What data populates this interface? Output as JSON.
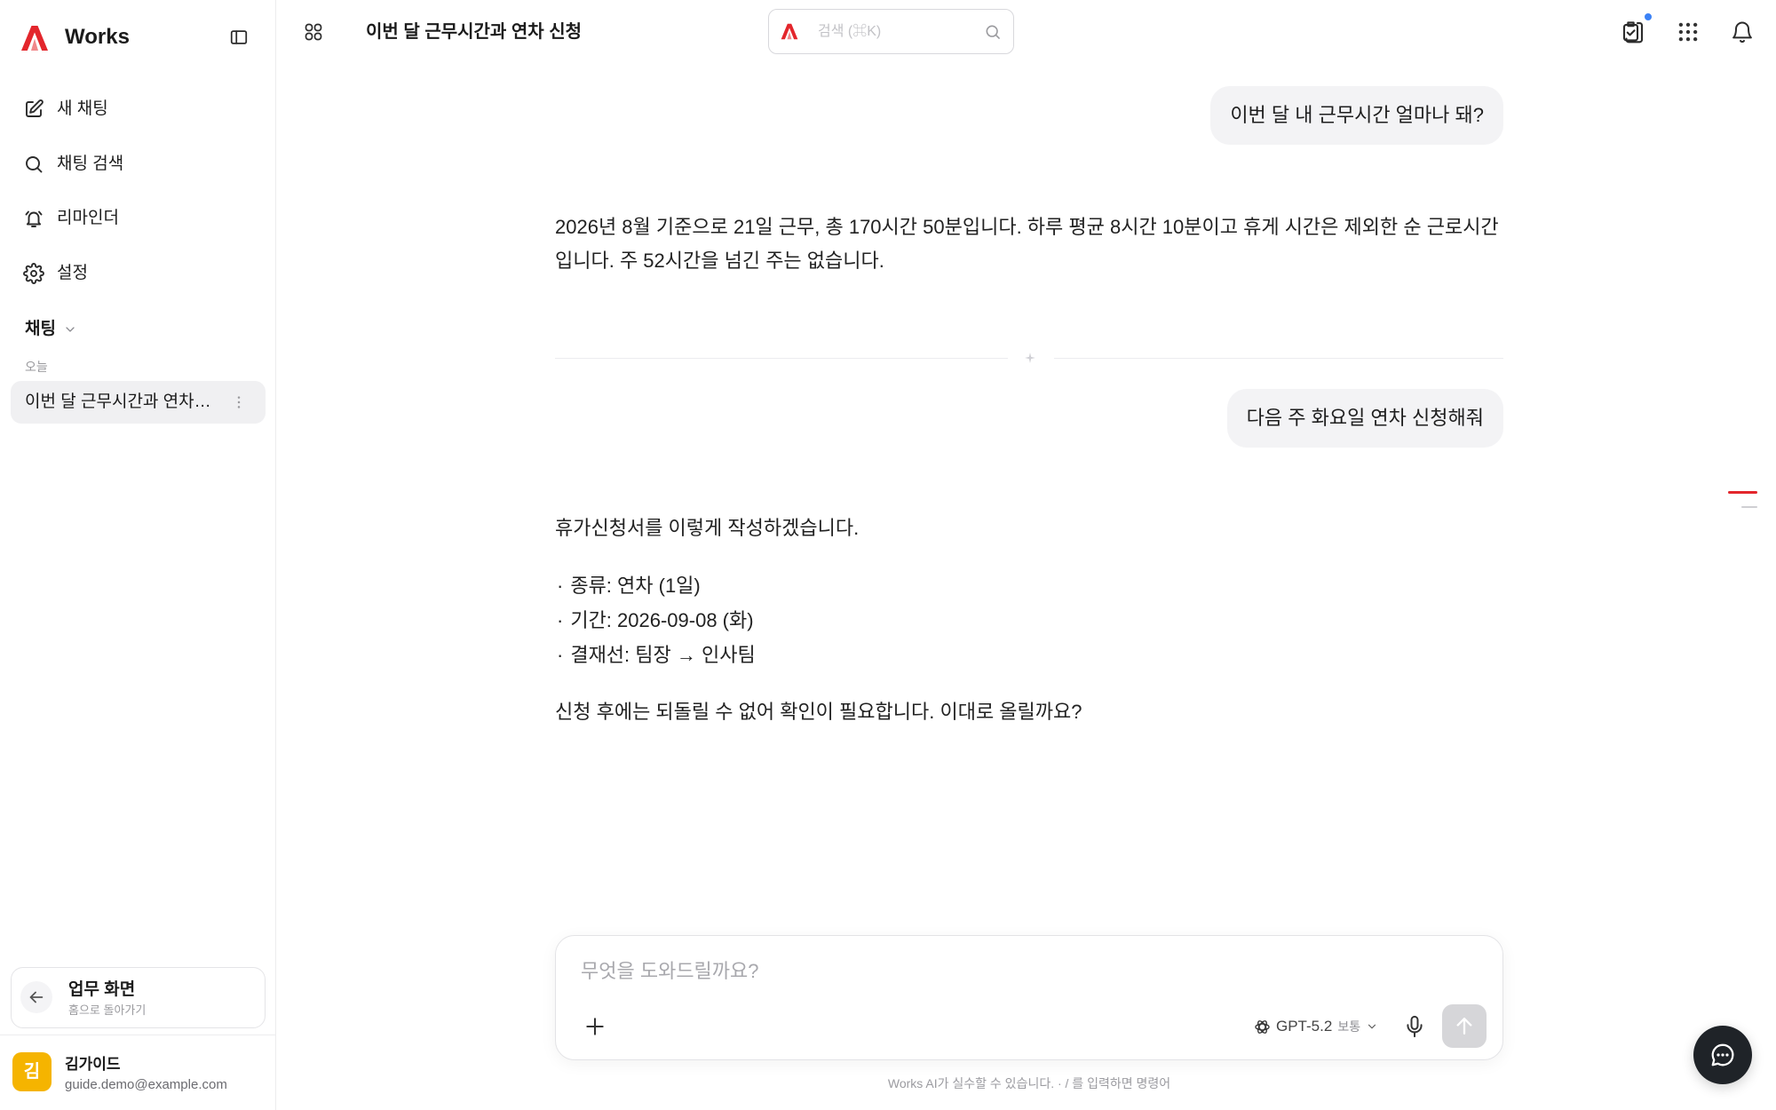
{
  "theme": {
    "accent": "#e3262c",
    "badge": "#3b82f6",
    "avatar": "#f5b400",
    "fab": "#1f2328"
  },
  "app": {
    "logo_text": "Works"
  },
  "sidebar": {
    "nav": [
      {
        "label": "새 채팅",
        "icon": "edit-icon"
      },
      {
        "label": "채팅 검색",
        "icon": "search-icon"
      },
      {
        "label": "리마인더",
        "icon": "alarm-icon"
      },
      {
        "label": "설정",
        "icon": "gear-icon"
      }
    ],
    "section_title": "채팅",
    "group_label": "오늘",
    "chats": [
      {
        "title": "이번 달 근무시간과 연차…",
        "selected": true
      }
    ],
    "workspace": {
      "title": "업무 화면",
      "subtitle": "홈으로 돌아가기"
    },
    "user": {
      "initial": "김",
      "name": "김가이드",
      "email": "guide.demo@example.com"
    }
  },
  "header": {
    "title": "이번 달 근무시간과 연차 신청",
    "search_placeholder": "검색 (⌘K)"
  },
  "conversation": [
    {
      "question": "이번 달 내 근무시간 얼마나 돼?",
      "answer": {
        "paragraphs": [
          "2026년 8월 기준으로 21일 근무, 총 170시간 50분입니다. 하루 평균 8시간 10분이고 휴게 시간은 제외한 순 근로시간입니다. 주 52시간을 넘긴 주는 없습니다."
        ]
      }
    },
    {
      "question": "다음 주 화요일 연차 신청해줘",
      "answer": {
        "intro": "휴가신청서를 이렇게 작성하겠습니다.",
        "items": [
          {
            "marker": "·",
            "text": "종류: 연차 (1일)"
          },
          {
            "marker": "·",
            "text": "기간: 2026-09-08 (화)"
          },
          {
            "marker": "·",
            "text": "결재선: 팀장 → 인사팀"
          }
        ],
        "closing": "신청 후에는 되돌릴 수 없어 확인이 필요합니다. 이대로 올릴까요?"
      }
    }
  ],
  "composer": {
    "placeholder": "무엇을 도와드릴까요?",
    "model_name": "GPT-5.2",
    "model_effort": "보통"
  },
  "footer": {
    "disclaimer": "Works AI가 실수할 수 있습니다. · / 를 입력하면 명령어"
  }
}
